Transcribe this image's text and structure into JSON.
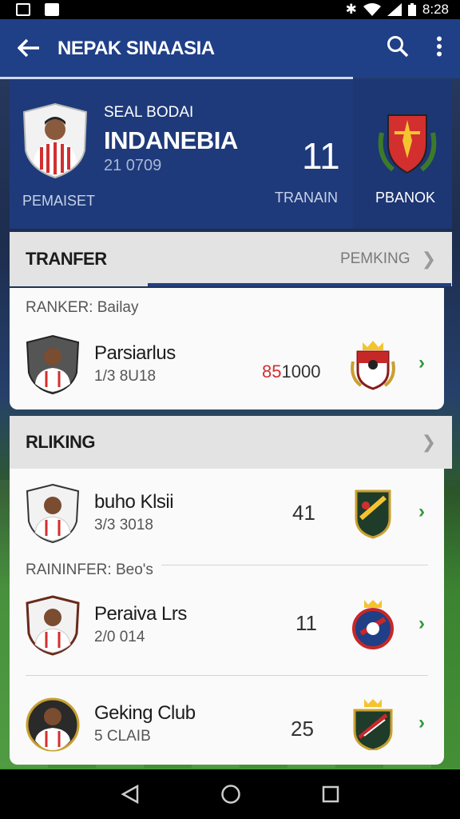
{
  "status_bar": {
    "time": "8:28"
  },
  "app_bar": {
    "title": "NEPAK SINAASIA"
  },
  "hero": {
    "subtitle": "SEAL BODAI",
    "name": "INDANEBIA",
    "date": "21 0709",
    "status_label": "PEMAISET",
    "number": "11",
    "train_label": "TRANAIN",
    "rank_label": "PBANOK"
  },
  "transfer_section": {
    "label": "TRANFER",
    "meta": "PEMKING",
    "subheading": "RANKER: Bailay",
    "rows": [
      {
        "name": "Parsiarlus",
        "date": "1/3 8U18",
        "value": "85",
        "value_suffix": "1000"
      }
    ]
  },
  "ranking_section": {
    "label": "RLIKING",
    "rows": [
      {
        "name": "buho Klsii",
        "date": "3/3 3018",
        "value": "41"
      },
      {
        "name": "Peraiva Lrs",
        "date": "2/0 014",
        "value": "11"
      },
      {
        "name": "Geking Club",
        "date": "5 CLAIB",
        "value": "25"
      }
    ],
    "subheading": "RAININFER: Beo's"
  },
  "colors": {
    "accent": "#1f3f87",
    "arrow": "#2a9a3a",
    "jersey_red": "#d32f2f"
  },
  "icons": [
    "back-arrow-icon",
    "search-icon",
    "more-vert-icon",
    "chevron-right-icon",
    "arrow-right-icon",
    "nav-back-icon",
    "nav-home-icon",
    "nav-recents-icon"
  ]
}
